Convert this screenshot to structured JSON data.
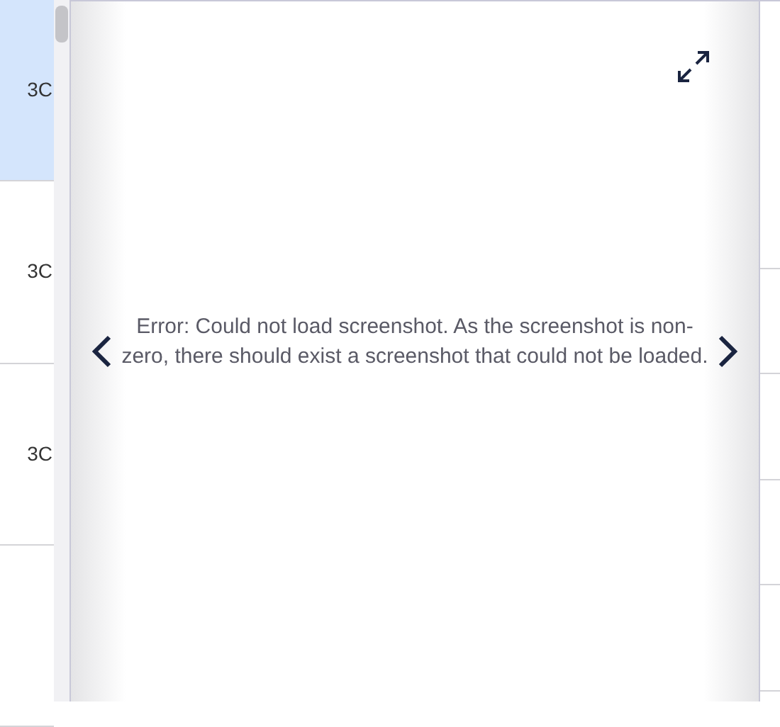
{
  "list": {
    "rows": [
      {
        "label": "3C",
        "selected": true
      },
      {
        "label": "3C",
        "selected": false
      },
      {
        "label": "3C",
        "selected": false
      },
      {
        "selected": false
      }
    ]
  },
  "viewer": {
    "message": "Error: Could not load screenshot. As the screenshot is non-zero, there should exist a screenshot that could not be loaded."
  }
}
